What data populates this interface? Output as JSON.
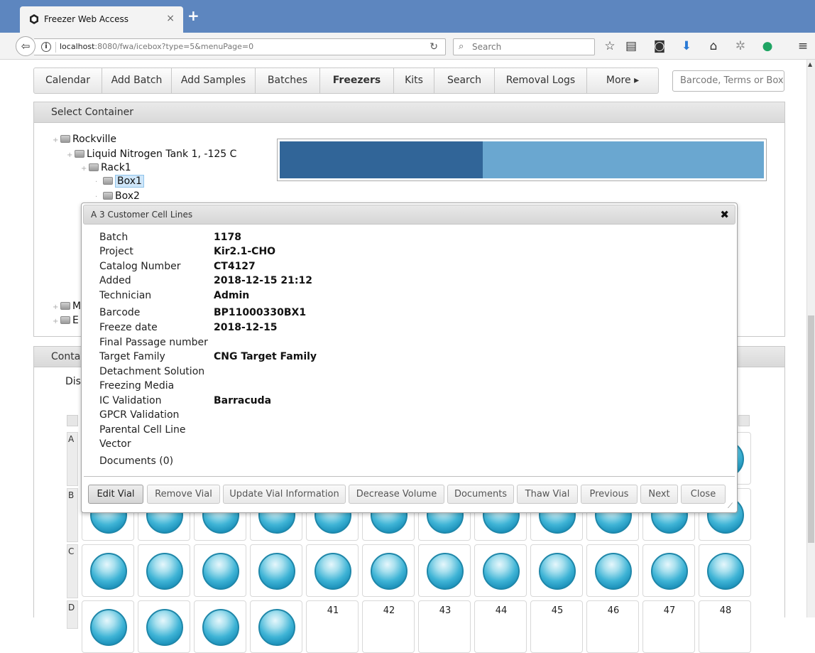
{
  "browser": {
    "tab_title": "Freezer Web Access",
    "tab_close": "×",
    "new_tab": "+",
    "url_host": "localhost",
    "url_rest": ":8080/fwa/icebox?type=5&menuPage=0",
    "search_placeholder": "Search"
  },
  "menu": {
    "items": [
      {
        "label": "Calendar"
      },
      {
        "label": "Add Batch"
      },
      {
        "label": "Add Samples"
      },
      {
        "label": "Batches"
      },
      {
        "label": "Freezers",
        "active": true
      },
      {
        "label": "Kits"
      },
      {
        "label": "Search"
      },
      {
        "label": "Removal Logs"
      },
      {
        "label": "More ▸"
      }
    ],
    "barcode_placeholder": "Barcode, Terms or Box"
  },
  "select_container": {
    "title": "Select Container",
    "tree": [
      {
        "label": "Rockville"
      },
      {
        "label": "Liquid Nitrogen Tank 1, -125 C"
      },
      {
        "label": "Rack1"
      },
      {
        "label": "Box1",
        "selected": true
      },
      {
        "label": "Box2"
      },
      {
        "label": "M"
      },
      {
        "label": "E"
      }
    ],
    "usage_fraction": 0.42
  },
  "contents": {
    "title_partial": "Conta",
    "display_partial": "Dis",
    "row_labels": [
      "A",
      "B",
      "C",
      "D"
    ],
    "row_d_numbers": [
      "41",
      "42",
      "43",
      "44",
      "45",
      "46",
      "47",
      "48"
    ]
  },
  "dialog": {
    "title": "A 3 Customer Cell Lines",
    "close_icon": "✖",
    "fields": [
      {
        "label": "Batch",
        "value": "1178"
      },
      {
        "label": "Project",
        "value": "Kir2.1-CHO"
      },
      {
        "label": "Catalog Number",
        "value": "CT4127"
      },
      {
        "label": "Added",
        "value": "2018-12-15 21:12"
      },
      {
        "label": "Technician",
        "value": "Admin"
      },
      {
        "label": "Barcode",
        "value": "BP11000330BX1"
      },
      {
        "label": "Freeze date",
        "value": "2018-12-15"
      },
      {
        "label": "Final Passage number",
        "value": ""
      },
      {
        "label": "Target Family",
        "value": "CNG Target Family"
      },
      {
        "label": "Detachment Solution",
        "value": ""
      },
      {
        "label": "Freezing Media",
        "value": ""
      },
      {
        "label": "IC Validation",
        "value": "Barracuda"
      },
      {
        "label": "GPCR Validation",
        "value": ""
      },
      {
        "label": "Parental Cell Line",
        "value": ""
      },
      {
        "label": "Vector",
        "value": ""
      },
      {
        "label": "Documents (0)",
        "value": ""
      }
    ],
    "buttons": [
      {
        "label": "Edit Vial"
      },
      {
        "label": "Remove Vial"
      },
      {
        "label": "Update Vial Information"
      },
      {
        "label": "Decrease Volume"
      },
      {
        "label": "Documents"
      },
      {
        "label": "Thaw Vial"
      },
      {
        "label": "Previous"
      },
      {
        "label": "Next"
      },
      {
        "label": "Close"
      }
    ]
  }
}
